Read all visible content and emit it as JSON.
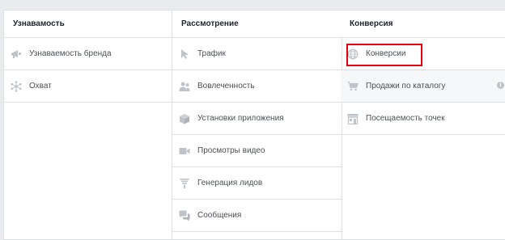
{
  "columns": [
    {
      "title": "Узнавамость",
      "items": [
        {
          "label": "Узнаваемость бренда",
          "icon": "megaphone-icon"
        },
        {
          "label": "Охват",
          "icon": "snowflake-icon"
        }
      ]
    },
    {
      "title": "Рассмотрение",
      "items": [
        {
          "label": "Трафик",
          "icon": "cursor-icon"
        },
        {
          "label": "Вовлеченность",
          "icon": "people-icon"
        },
        {
          "label": "Установки приложения",
          "icon": "cube-icon"
        },
        {
          "label": "Просмотры видео",
          "icon": "video-camera-icon"
        },
        {
          "label": "Генерация лидов",
          "icon": "funnel-icon"
        },
        {
          "label": "Сообщения",
          "icon": "chat-bubbles-icon"
        }
      ]
    },
    {
      "title": "Конверсия",
      "items": [
        {
          "label": "Конверсии",
          "icon": "globe-icon",
          "selected": true
        },
        {
          "label": "Продажи по каталогу",
          "icon": "shopping-cart-icon",
          "info": "i"
        },
        {
          "label": "Посещаемость точек",
          "icon": "store-icon"
        }
      ]
    }
  ],
  "colors": {
    "icon": "#bec2c9",
    "text": "#4b4f56",
    "selection": "#e2000f",
    "border": "#dddfe2"
  }
}
